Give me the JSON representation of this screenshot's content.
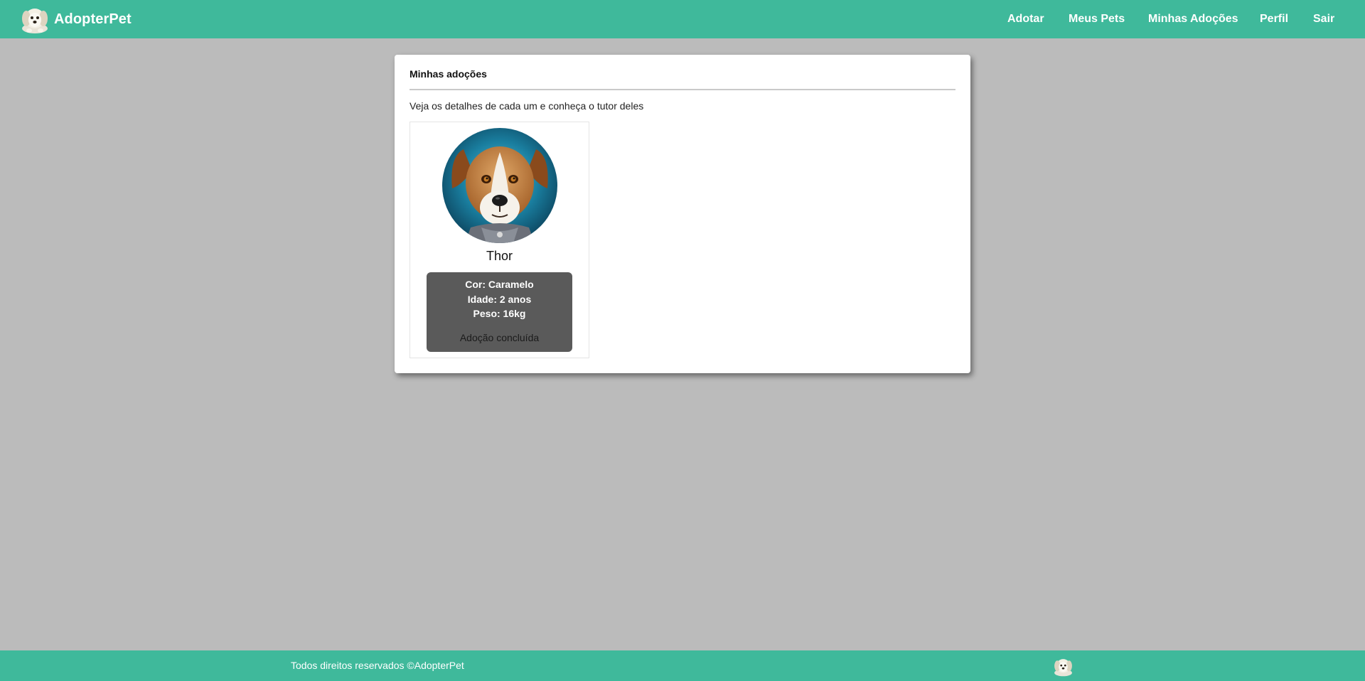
{
  "header": {
    "brand_name": "AdopterPet",
    "nav": {
      "adotar": "Adotar",
      "meus_pets": "Meus Pets",
      "minhas_adocoes": "Minhas Adoções",
      "perfil": "Perfil",
      "sair": "Sair"
    },
    "background_color": "#3fb99b"
  },
  "main": {
    "title": "Minhas adoções",
    "subtitle": "Veja os detalhes de cada um e conheça o tutor deles",
    "pets": [
      {
        "name": "Thor",
        "cor": "Cor: Caramelo",
        "idade": "Idade: 2 anos",
        "peso": "Peso: 16kg",
        "status": "Adoção concluída"
      }
    ]
  },
  "footer": {
    "text": "Todos direitos reservados ©AdopterPet"
  },
  "icons": {
    "brand_logo": "puppy-logo-icon",
    "footer_logo": "puppy-logo-icon",
    "pet_photo": "dog-portrait"
  }
}
